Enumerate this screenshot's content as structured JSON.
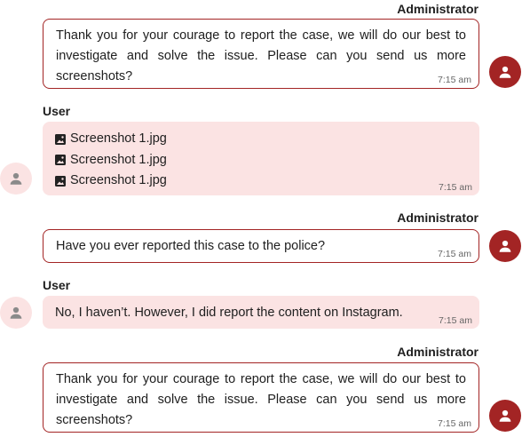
{
  "messages": [
    {
      "sender": "Administrator",
      "text": "Thank you for your courage to report the case, we will do our best to investigate and solve the issue. Please can you send us more screenshots?",
      "time": "7:15 am"
    },
    {
      "sender": "User",
      "attachments": [
        "Screenshot 1.jpg",
        "Screenshot 1.jpg",
        "Screenshot 1.jpg"
      ],
      "time": "7:15 am"
    },
    {
      "sender": "Administrator",
      "text": "Have you ever reported this case to the police?",
      "time": "7:15 am"
    },
    {
      "sender": "User",
      "text": "No, I haven’t. However, I did report the content on Instagram.",
      "time": "7:15 am"
    },
    {
      "sender": "Administrator",
      "text": "Thank you for your courage to report the case, we will do our best to investigate and solve the issue. Please can you send us more screenshots?",
      "time": "7:15 am"
    }
  ],
  "icons": {
    "avatar": "person-icon",
    "attachment": "image-icon"
  },
  "colors": {
    "admin_accent": "#a32424",
    "user_bubble": "#fbe3e3"
  }
}
